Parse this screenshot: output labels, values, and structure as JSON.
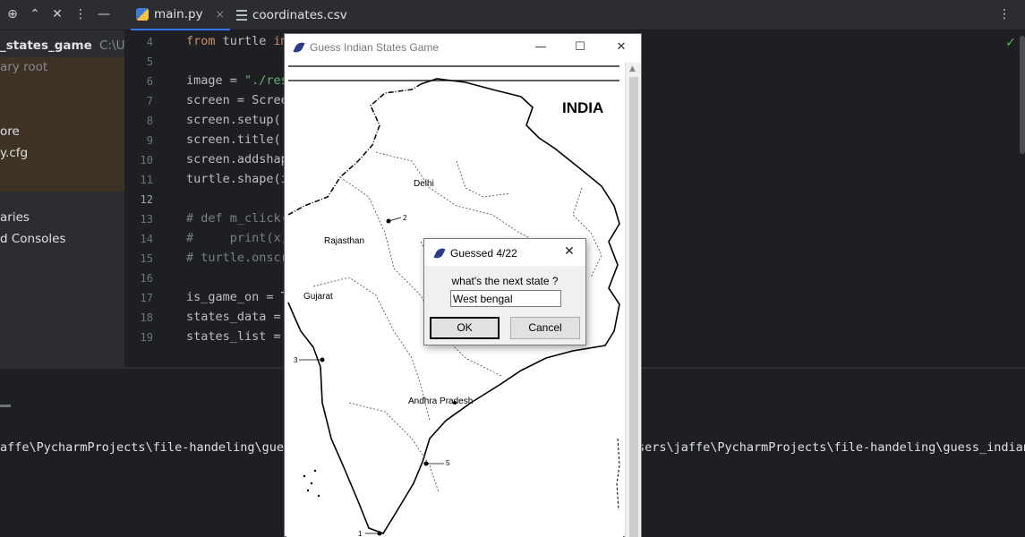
{
  "ide": {
    "tabs": [
      {
        "label": "main.py",
        "close": "×"
      },
      {
        "label": "coordinates.csv"
      }
    ],
    "project": {
      "root": "_states_game",
      "root_path": "C:\\User",
      "subtitle": "ary root",
      "items": [
        "ore",
        "y.cfg",
        "aries",
        "d Consoles"
      ]
    },
    "line_numbers": [
      "4",
      "5",
      "6",
      "7",
      "8",
      "9",
      "10",
      "11",
      "12",
      "13",
      "14",
      "15",
      "16",
      "17",
      "18",
      "19"
    ],
    "code_lines": [
      {
        "parts": [
          {
            "t": "from",
            "c": "kw"
          },
          {
            "t": " turtle ",
            "c": ""
          },
          {
            "t": "im",
            "c": "kw"
          }
        ]
      },
      {
        "parts": []
      },
      {
        "parts": [
          {
            "t": "image = ",
            "c": ""
          },
          {
            "t": "\"./res",
            "c": "str"
          }
        ]
      },
      {
        "parts": [
          {
            "t": "screen = Scree",
            "c": ""
          }
        ]
      },
      {
        "parts": [
          {
            "t": "screen.setup(",
            "c": ""
          }
        ]
      },
      {
        "parts": [
          {
            "t": "screen.title(",
            "c": ""
          }
        ]
      },
      {
        "parts": [
          {
            "t": "screen.addshap",
            "c": ""
          }
        ]
      },
      {
        "parts": [
          {
            "t": "turtle.shape(i",
            "c": ""
          }
        ]
      },
      {
        "parts": []
      },
      {
        "parts": [
          {
            "t": "# def m_click(",
            "c": "cm"
          }
        ]
      },
      {
        "parts": [
          {
            "t": "#     print(x,",
            "c": "cm"
          }
        ]
      },
      {
        "parts": [
          {
            "t": "# turtle.onscr",
            "c": "cm"
          }
        ]
      },
      {
        "parts": []
      },
      {
        "parts": [
          {
            "t": "is_game_on = T",
            "c": ""
          }
        ]
      },
      {
        "parts": [
          {
            "t": "states_data = ",
            "c": ""
          }
        ]
      },
      {
        "parts": [
          {
            "t": "states_list = ",
            "c": ""
          }
        ]
      }
    ],
    "run_left": "affe\\PycharmProjects\\file-handeling\\gues",
    "run_right": "sers\\jaffe\\PycharmProjects\\file-handeling\\guess_indian"
  },
  "turtle_window": {
    "title": "Guess Indian States Game",
    "minimize": "—",
    "maximize": "☐",
    "close": "✕"
  },
  "map": {
    "title": "INDIA",
    "labels": [
      {
        "text": "Delhi"
      },
      {
        "text": "Rajasthan"
      },
      {
        "text": "Gujarat"
      },
      {
        "text": "Andhra Pradesh"
      }
    ],
    "markers": [
      "2",
      "3",
      "5",
      "1"
    ]
  },
  "dialog": {
    "title": "Guessed 4/22",
    "prompt": "what's the next state ?",
    "input_value": "West bengal",
    "ok_label": "OK",
    "cancel_label": "Cancel",
    "close": "✕"
  },
  "colors": {
    "ide_bg": "#1e1f22",
    "panel_bg": "#2b2d30",
    "accent": "#3574f0",
    "keyword": "#cf8e6d",
    "string": "#6aab73",
    "comment": "#7a7e85"
  }
}
